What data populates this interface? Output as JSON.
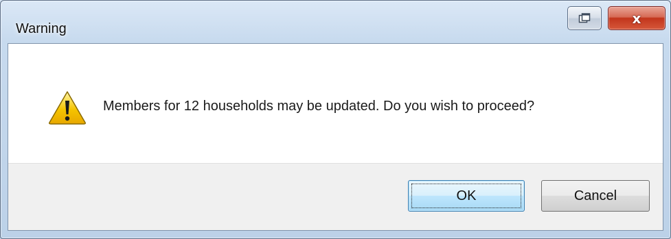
{
  "window": {
    "title": "Warning"
  },
  "caption_buttons": {
    "restore_icon": "window-restore-icon",
    "close_icon": "close-icon",
    "close_glyph": "x"
  },
  "dialog": {
    "icon": "warning-icon",
    "message": "Members for 12 households may be updated.  Do you wish to proceed?"
  },
  "buttons": {
    "ok_label": "OK",
    "cancel_label": "Cancel"
  },
  "colors": {
    "close_button": "#c2351c",
    "ok_button_border": "#3c7fb1",
    "warning_icon_fill": "#f5c400"
  }
}
